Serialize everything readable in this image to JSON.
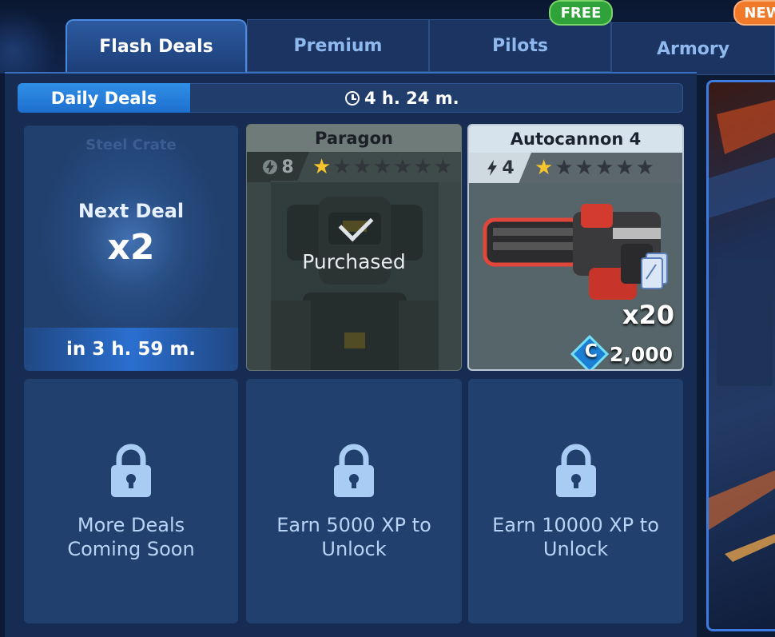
{
  "tabs": [
    {
      "label": "Flash Deals",
      "active": true
    },
    {
      "label": "Premium",
      "active": false
    },
    {
      "label": "Pilots",
      "active": false,
      "badge": "FREE"
    },
    {
      "label": "Armory",
      "active": false,
      "badge": "NEW"
    }
  ],
  "daily": {
    "label": "Daily Deals",
    "timer": "4 h. 24 m."
  },
  "next_deal": {
    "ghost_title": "Steel Crate",
    "label": "Next Deal",
    "multiplier": "x2",
    "timer": "in 3 h. 59 m."
  },
  "paragon": {
    "title": "Paragon",
    "power": "8",
    "stars_filled": 1,
    "stars_total": 7,
    "status": "Purchased"
  },
  "autocannon": {
    "title": "Autocannon 4",
    "power": "4",
    "stars_filled": 1,
    "stars_total": 6,
    "quantity": "x20",
    "price": "2,000"
  },
  "locked": [
    {
      "text_line1": "More Deals",
      "text_line2": "Coming Soon"
    },
    {
      "text_line1": "Earn 5000 XP to",
      "text_line2": "Unlock"
    },
    {
      "text_line1": "Earn 10000 XP to",
      "text_line2": "Unlock"
    }
  ],
  "colors": {
    "accent": "#2f8fe6",
    "free_badge": "#2fa33a",
    "new_badge": "#f07a2a",
    "star": "#f7c52b"
  }
}
